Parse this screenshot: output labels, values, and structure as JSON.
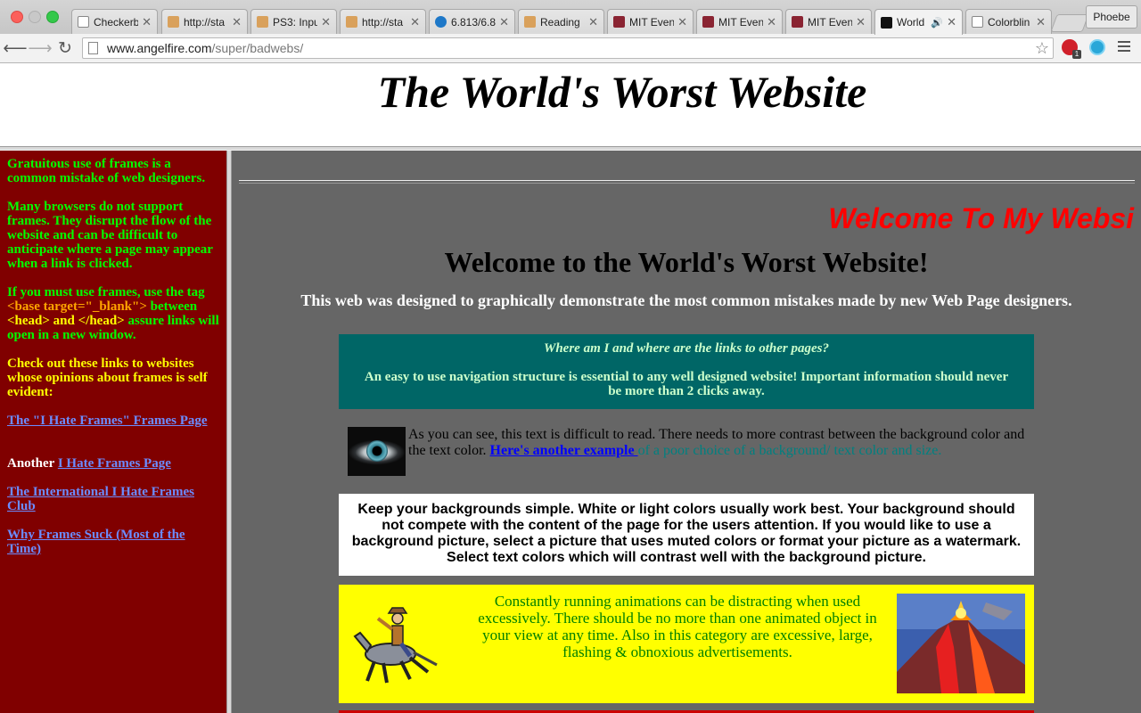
{
  "browser": {
    "tabs": [
      {
        "title": "Checkerb",
        "icon": "doc-icon"
      },
      {
        "title": "http://sta",
        "icon": "page-icon"
      },
      {
        "title": "PS3: Inpu",
        "icon": "page-icon"
      },
      {
        "title": "http://sta",
        "icon": "page-icon"
      },
      {
        "title": "6.813/6.8",
        "icon": "p-icon"
      },
      {
        "title": "Reading",
        "icon": "page-icon"
      },
      {
        "title": "MIT Even",
        "icon": "mit-icon"
      },
      {
        "title": "MIT Even",
        "icon": "mit-icon"
      },
      {
        "title": "MIT Even",
        "icon": "mit-icon"
      },
      {
        "title": "World",
        "icon": "site-icon"
      },
      {
        "title": "Colorblin",
        "icon": "doc-icon"
      }
    ],
    "profile": "Phoebe",
    "url_host": "www.angelfire.com",
    "url_path": "/super/badwebs/",
    "extension_badge": "1"
  },
  "page": {
    "title": "The World's Worst Website",
    "left": {
      "p1": "Gratuitous use of frames is a common mistake of web designers.",
      "p2": "Many browsers do not support frames. They disrupt the flow of the website and can be difficult to anticipate where a page may appear when a link is clicked.",
      "p3_a": "If you must use frames, use the tag ",
      "p3_code": "<base target=\"_blank\">",
      "p3_b": " between ",
      "p3_head": "<head> and </head>",
      "p3_c": " assure links will open in a new window.",
      "p4": "Check out these links to websites whose opinions about frames is self evident:",
      "link1": "The \"I Hate Frames\" Frames Page",
      "another": "Another ",
      "link2": "I Hate Frames Page",
      "link3": "The International I Hate Frames Club",
      "link4": "Why Frames Suck (Most of the Time)"
    },
    "main": {
      "marquee": "Welcome To My Websi",
      "heading": "Welcome to the World's Worst Website!",
      "subheading": "This web was designed to graphically demonstrate the most common mistakes made by new Web Page designers.",
      "nav_question": "Where am I and where are the links to other pages?",
      "nav_answer": "An easy to use navigation structure is essential to any well designed website! Important information should never be more than 2 clicks away.",
      "contrast_text": "As you can see, this text is difficult to read. There needs to more contrast between the background color and the text color. ",
      "contrast_link": "Here's another example ",
      "contrast_tail": "of a poor choice of a background/ text color and size.",
      "background_text": "Keep your backgrounds simple. White or light colors usually work best. Your background should not compete with the content of the page for the users attention. If you would like to use a background picture, select a picture that uses muted colors or format your picture as a watermark. Select text colors which will contrast well with the background picture.",
      "animation_text": "Constantly running animations can be distracting when used excessively. There should be no more than one animated object in your view at any time. Also in this category are excessive, large, flashing & obnoxious advertisements."
    }
  }
}
